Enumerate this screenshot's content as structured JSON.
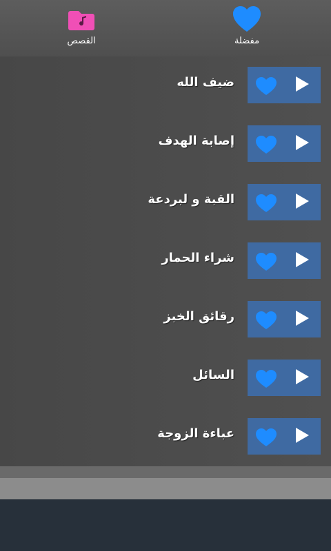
{
  "tabs": {
    "stories_label": "القصص",
    "favorites_label": "مفضلة"
  },
  "colors": {
    "accent_blue": "#1e8cff",
    "button_bg": "#3f6aa2",
    "folder_pink": "#f04fb6"
  },
  "icons": {
    "stories": "folder-music-icon",
    "favorites": "heart-icon",
    "row_favorite": "heart-icon",
    "row_play": "play-icon"
  },
  "items": [
    {
      "title": "ضيف الله"
    },
    {
      "title": "إصابة الهدف"
    },
    {
      "title": "القبة و لبردعة"
    },
    {
      "title": "شراء الحمار"
    },
    {
      "title": "رقائق الخبز"
    },
    {
      "title": "السائل"
    },
    {
      "title": "عباءة الزوجة"
    }
  ]
}
